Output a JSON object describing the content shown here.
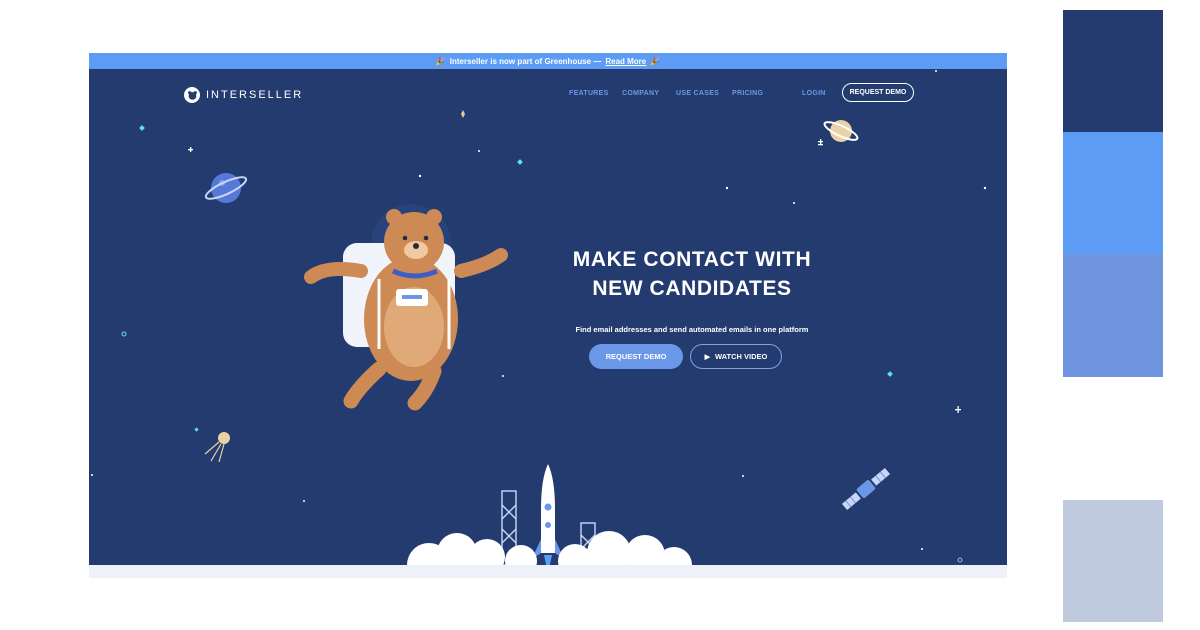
{
  "banner": {
    "text": "Interseller is now part of Greenhouse —",
    "link": "Read More",
    "emoji": "🎉"
  },
  "header": {
    "logo_text": "INTERSELLER",
    "nav": [
      "FEATURES",
      "COMPANY",
      "USE CASES",
      "PRICING"
    ],
    "login": "LOGIN",
    "request_demo": "REQUEST DEMO"
  },
  "hero": {
    "headline_line1": "MAKE CONTACT WITH",
    "headline_line2": "NEW CANDIDATES",
    "subtitle": "Find email addresses and send automated emails in one platform",
    "primary_button": "REQUEST DEMO",
    "secondary_button": "WATCH VIDEO"
  },
  "palette": [
    "#233b6e",
    "#5c9cf5",
    "#6f95df",
    "#c0cadf"
  ],
  "icons": [
    "planet-icon",
    "bear-astronaut-icon",
    "rocket-icon",
    "satellite-icon",
    "sputnik-icon",
    "star-icon",
    "play-icon"
  ]
}
